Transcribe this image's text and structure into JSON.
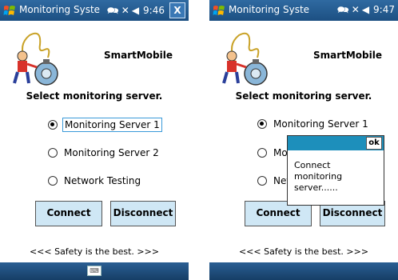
{
  "colors": {
    "titlebar": "#1c4f82",
    "button_bg": "#cfe7f5",
    "popup_header": "#1d8fbb",
    "focus_border": "#3a9ad9"
  },
  "left": {
    "title": "Monitoring Syste",
    "time": "9:46",
    "status_icons": [
      "chat-bubble-icon",
      "signal-off-icon",
      "volume-icon"
    ],
    "close_label": "X",
    "app_name": "SmartMobile",
    "heading": "Select monitoring server.",
    "options": [
      {
        "label": "Monitoring Server 1",
        "checked": true,
        "focused": true
      },
      {
        "label": "Monitoring Server 2",
        "checked": false,
        "focused": false
      },
      {
        "label": "Network Testing",
        "checked": false,
        "focused": false
      }
    ],
    "connect_label": "Connect",
    "disconnect_label": "Disconnect",
    "footer": "<<< Safety is the best. >>>"
  },
  "right": {
    "title": "Monitoring Syste",
    "time": "9:47",
    "status_icons": [
      "chat-bubble-icon",
      "signal-off-icon",
      "volume-icon"
    ],
    "app_name": "SmartMobile",
    "heading": "Select monitoring server.",
    "options": [
      {
        "label": "Monitoring Server 1",
        "checked": true
      },
      {
        "label": "Mon",
        "checked": false
      },
      {
        "label": "Netv",
        "checked": false
      }
    ],
    "connect_label": "Connect",
    "disconnect_label": "Disconnect",
    "footer": "<<< Safety is the best. >>>",
    "popup": {
      "ok_label": "ok",
      "message": "Connect monitoring server......"
    }
  }
}
